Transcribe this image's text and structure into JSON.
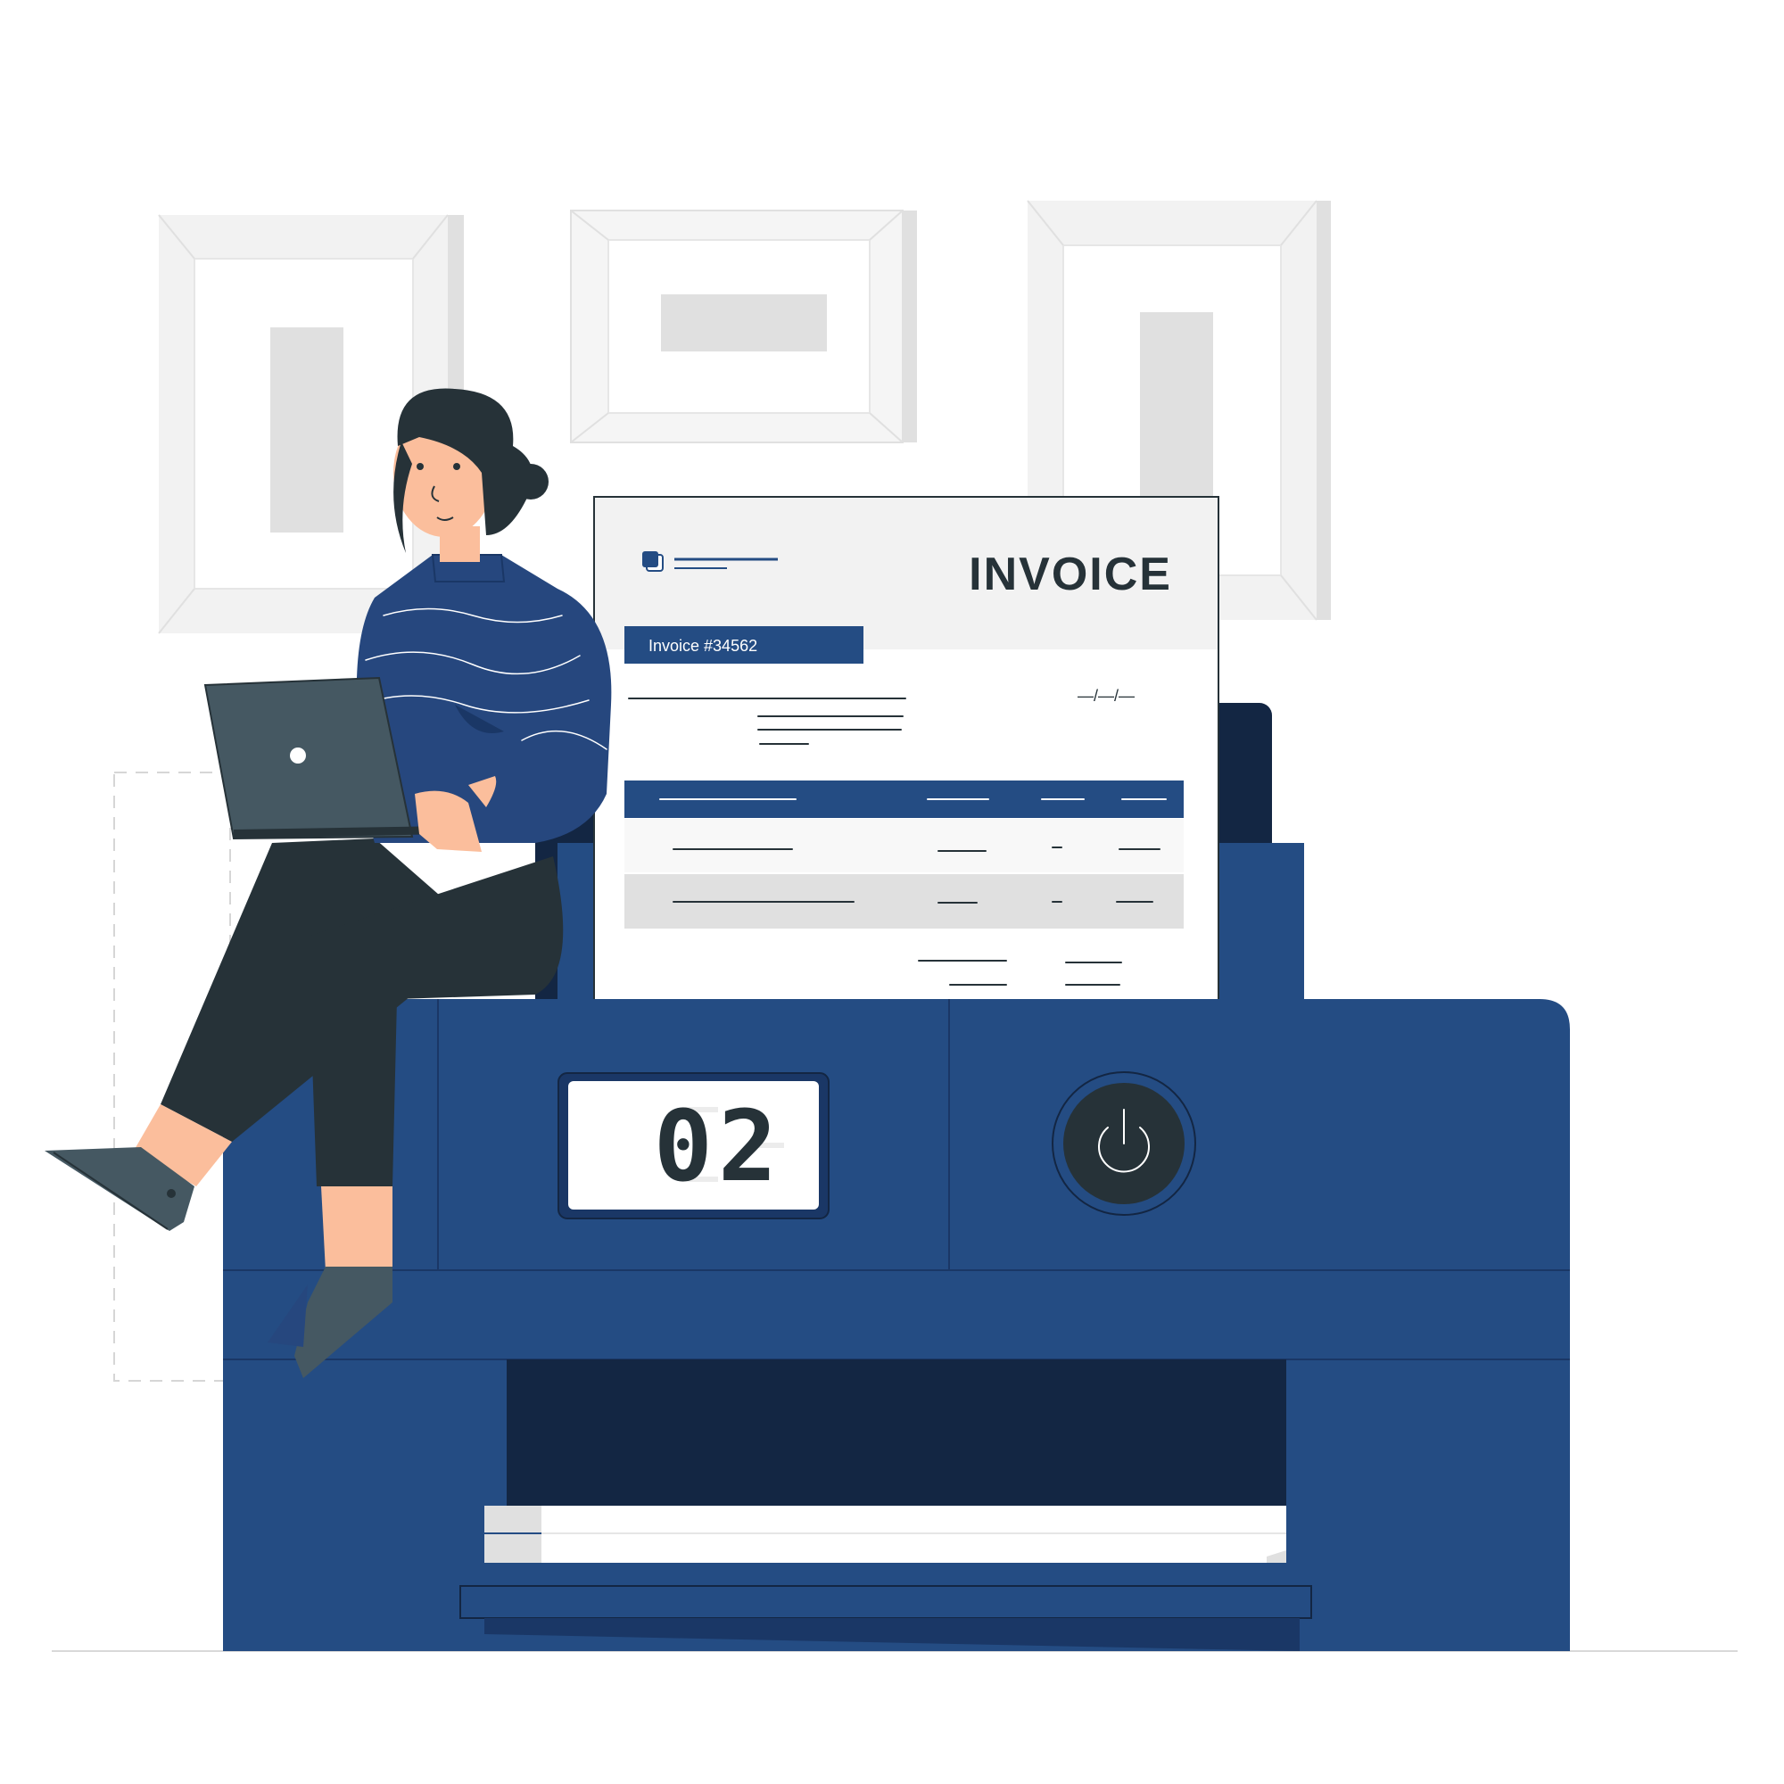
{
  "invoice": {
    "title": "INVOICE",
    "number_label": "Invoice  #34562",
    "date_placeholder": "—/—/—"
  },
  "printer": {
    "counter_display": "02"
  },
  "colors": {
    "printer_blue": "#244C83",
    "printer_dark": "#132643",
    "sweater_blue": "#26477E",
    "laptop_gray": "#455862",
    "pants_black": "#263238",
    "skin": "#FBBE9C",
    "frame_gray": "#E0E0E0"
  }
}
